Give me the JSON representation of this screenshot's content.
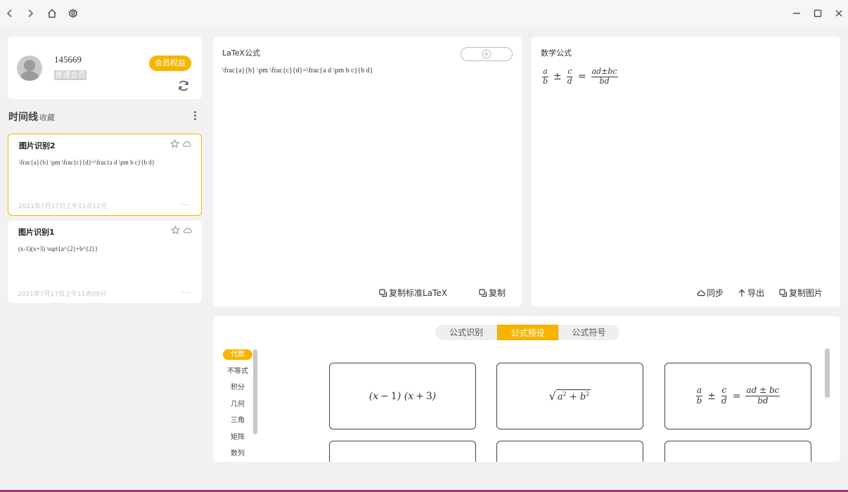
{
  "titlebar": {
    "back_icon": "chevron-left-icon",
    "forward_icon": "chevron-right-icon",
    "home_icon": "home-icon",
    "settings_icon": "gear-icon",
    "minimize_icon": "minimize-icon",
    "maximize_icon": "maximize-icon",
    "close_icon": "close-icon"
  },
  "profile": {
    "user_id": "145669",
    "level": "普通会员",
    "vip_button": "会员权益"
  },
  "timeline": {
    "title": "时间线",
    "favorites": "收藏",
    "items": [
      {
        "name": "图片识别2",
        "formula": "\\frac{a}{b} \\pm \\frac{c}{d}=\\frac{a d \\pm b c}{b d}",
        "date": "2021年7月17日上午11点11分",
        "more": "···"
      },
      {
        "name": "图片识别1",
        "formula": "(x-1)(x+3) \\sqrt{a^{2}+b^{2}}",
        "date": "2021年7月17日上午11点09分",
        "more": "···"
      }
    ]
  },
  "latex_panel": {
    "title": "LaTeX公式",
    "code": "\\frac{a}{b} \\pm \\frac{c}{d}=\\frac{a d \\pm b c}{b d}",
    "copy_standard": "复制标准LaTeX",
    "copy": "复制"
  },
  "math_panel": {
    "title": "数学公式",
    "sync": "同步",
    "export": "导出",
    "copy_image": "复制图片"
  },
  "preset_panel": {
    "tabs": [
      "公式识别",
      "公式预设",
      "公式符号"
    ],
    "active_tab": "公式预设",
    "categories": [
      "代数",
      "不等式",
      "积分",
      "几何",
      "三角",
      "矩阵",
      "数列"
    ],
    "active_category": "代数",
    "presets": [
      "(x − 1) (x + 3)",
      "√(a² + b²)",
      "a/b ± c/d = (ad ± bc)/bd"
    ]
  },
  "colors": {
    "accent": "#f7b500",
    "background": "#f1f1f1"
  }
}
